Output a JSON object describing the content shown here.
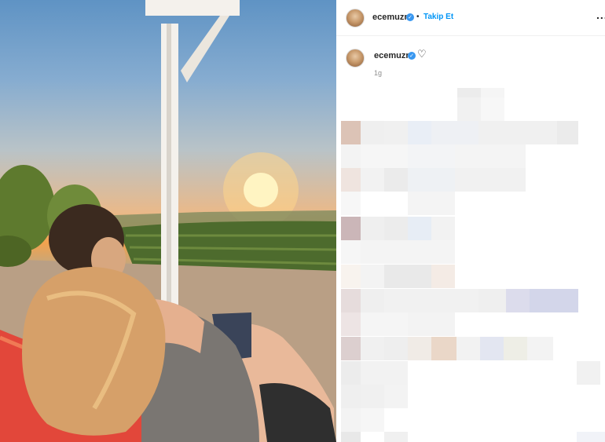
{
  "post": {
    "username": "ecemuzn",
    "verified_icon": "verified-badge-icon",
    "separator": "•",
    "follow_label": "Takip Et",
    "more_label": "...",
    "caption_username": "ecemuzn",
    "like_icon": "heart-outline-icon",
    "timestamp": "1g"
  },
  "colors": {
    "link": "#0095f6",
    "verified": "#3897f0",
    "text": "#262626",
    "muted": "#8e8e8e"
  }
}
